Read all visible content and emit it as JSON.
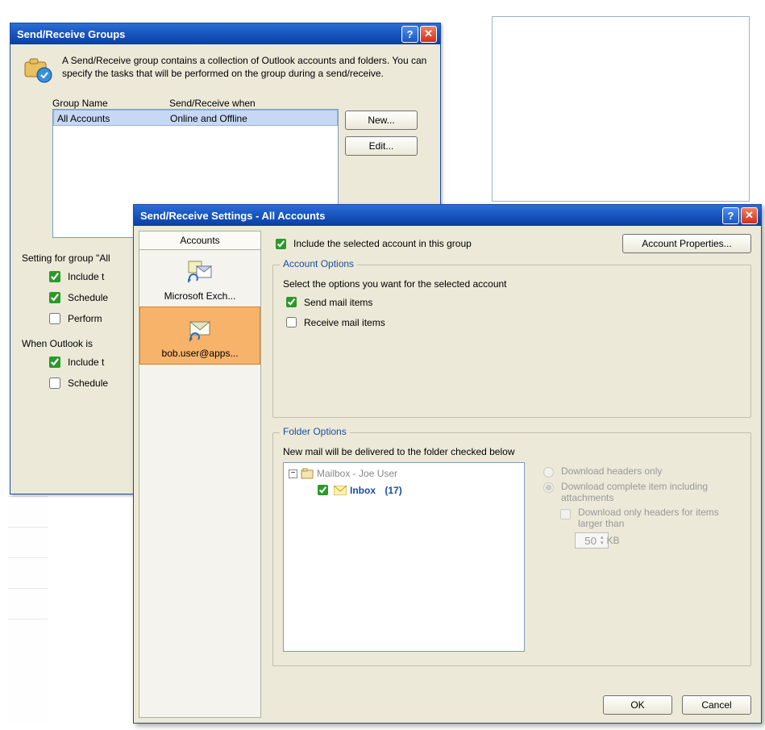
{
  "groups_dialog": {
    "title": "Send/Receive Groups",
    "info_text": "A Send/Receive group contains a collection of Outlook accounts and folders. You can specify the tasks that will be performed on the group during a send/receive.",
    "col_name": "Group Name",
    "col_when": "Send/Receive when",
    "rows": [
      {
        "name": "All Accounts",
        "when": "Online and Offline"
      }
    ],
    "btn_new": "New...",
    "btn_edit": "Edit...",
    "settings_label": "Setting for group \"All",
    "chk_include": "Include t",
    "chk_schedule": "Schedule",
    "chk_perform": "Perform",
    "when_offline_label": "When Outlook is",
    "chk_include2": "Include t",
    "chk_schedule2": "Schedule"
  },
  "settings_dialog": {
    "title": "Send/Receive Settings - All Accounts",
    "accounts_header": "Accounts",
    "accounts": [
      {
        "label": "Microsoft Exch...",
        "selected": false
      },
      {
        "label": "bob.user@apps...",
        "selected": true
      }
    ],
    "include_label": "Include the selected account in this group",
    "account_properties_btn": "Account Properties...",
    "account_options_title": "Account Options",
    "account_options_desc": "Select the options you want for the selected account",
    "chk_send": "Send mail items",
    "chk_receive": "Receive mail items",
    "folder_options_title": "Folder Options",
    "folder_options_desc": "New mail will be delivered to the folder checked below",
    "tree_root": "Mailbox - Joe User",
    "tree_inbox": "Inbox",
    "tree_inbox_count": "(17)",
    "dl_headers": "Download headers only",
    "dl_complete": "Download complete item including attachments",
    "dl_only_headers": "Download only headers for items larger than",
    "dl_size": "50",
    "dl_kb": "KB",
    "btn_ok": "OK",
    "btn_cancel": "Cancel"
  }
}
